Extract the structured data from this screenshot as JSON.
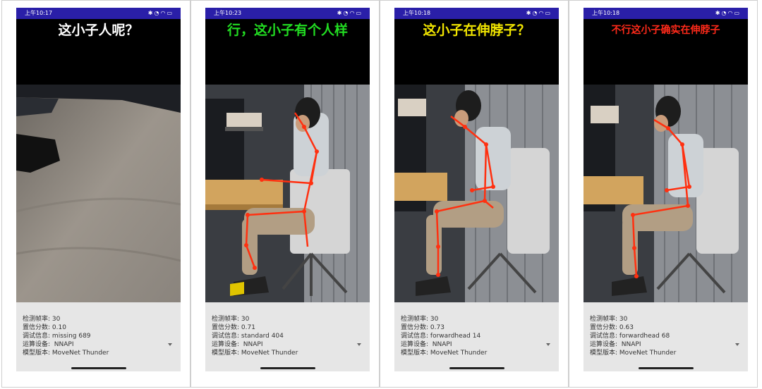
{
  "labels": {
    "fps": "检测帧率:",
    "score": "置信分数:",
    "debug": "调试信息:",
    "device": "运算设备:",
    "model": "模型版本:"
  },
  "screens": [
    {
      "time": "上午10:17",
      "title": "这小子人呢？",
      "title_color": "#ffffff",
      "fps": "30",
      "score": "0.10",
      "debug": "missing 689",
      "device": "NNAPI",
      "model": "MoveNet Thunder"
    },
    {
      "time": "上午10:23",
      "title": "行，这小子有个人样",
      "title_color": "#22dd22",
      "fps": "30",
      "score": "0.71",
      "debug": "standard 404",
      "device": "NNAPI",
      "model": "MoveNet Thunder"
    },
    {
      "time": "上午10:18",
      "title": "这小子在伸脖子？",
      "title_color": "#f2e600",
      "fps": "30",
      "score": "0.73",
      "debug": "forwardhead 14",
      "device": "NNAPI",
      "model": "MoveNet Thunder"
    },
    {
      "time": "上午10:18",
      "title": "不行这小子确实在伸脖子",
      "title_color": "#ff2a1a",
      "fps": "30",
      "score": "0.63",
      "debug": "forwardhead 68",
      "device": "NNAPI",
      "model": "MoveNet Thunder"
    }
  ],
  "icons": {
    "status": [
      "bluetooth-icon",
      "alarm-icon",
      "wifi-icon",
      "battery-icon"
    ],
    "skeleton_color": "#ff3010",
    "device_dropdown": "chevron-down-icon"
  }
}
